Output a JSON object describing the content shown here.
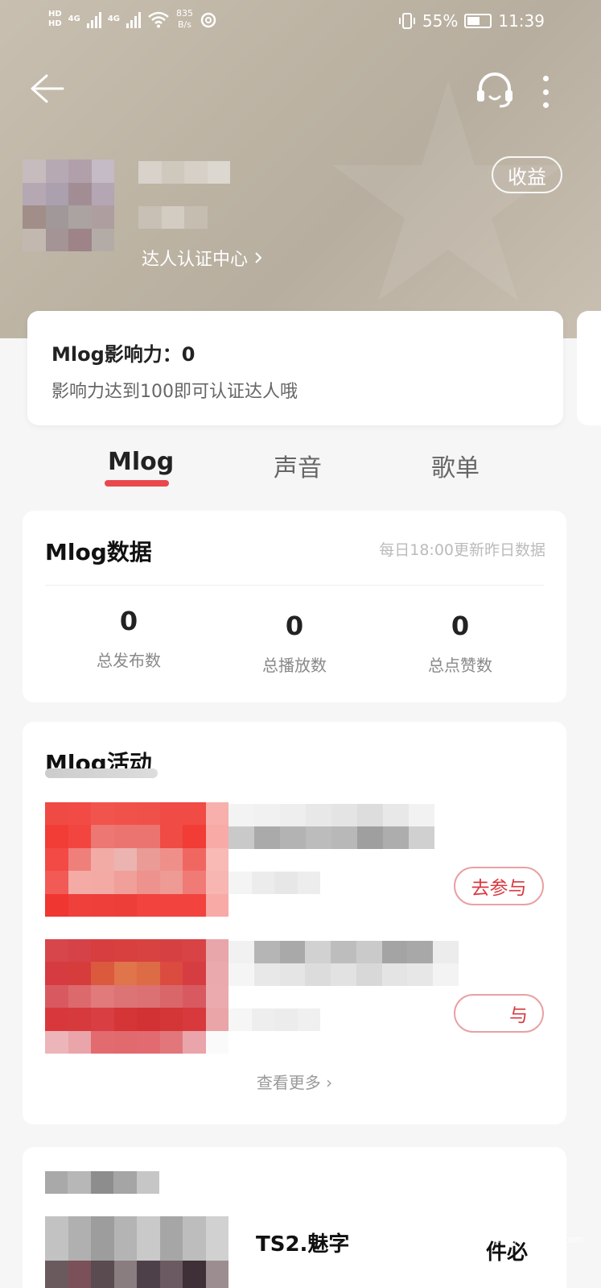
{
  "status_bar": {
    "hd1": "HD",
    "hd2": "HD",
    "net1": "4G",
    "net2": "4G",
    "speed_value": "835",
    "speed_unit": "B/s",
    "battery": "55%",
    "time": "11:39",
    "battery_level": 0.55
  },
  "header": {
    "cert_center_label": "达人认证中心",
    "earnings_button": "收益"
  },
  "influence": {
    "label": "Mlog影响力：0",
    "desc": "影响力达到100即可认证达人哦"
  },
  "tabs": [
    {
      "label": "Mlog",
      "active": true
    },
    {
      "label": "声音",
      "active": false
    },
    {
      "label": "歌单",
      "active": false
    }
  ],
  "data_card": {
    "title": "Mlog数据",
    "note": "每日18:00更新昨日数据",
    "stats": [
      {
        "value": "0",
        "label": "总发布数"
      },
      {
        "value": "0",
        "label": "总播放数"
      },
      {
        "value": "0",
        "label": "总点赞数"
      }
    ]
  },
  "activity_card": {
    "title": "Mlog活动",
    "join_button": "去参与",
    "join_button_partial": "与",
    "see_more": "查看更多 ›"
  },
  "bottom_card": {
    "text1": "TS2.魅字",
    "text2": "件必"
  },
  "watermark": {
    "main": "Bai 经验",
    "sub": "jingyan.baidu.com"
  },
  "colors": {
    "accent": "#e8353b",
    "hero_bg": "#bcb3a3"
  }
}
